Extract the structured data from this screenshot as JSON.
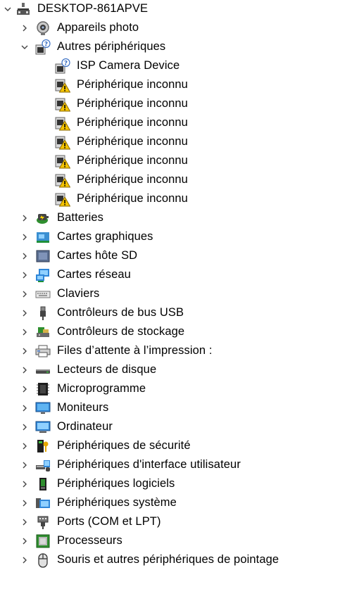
{
  "root": {
    "label": "DESKTOP-861APVE",
    "icon": "computer-tree-icon",
    "expanded": true
  },
  "categories": [
    {
      "label": "Appareils photo",
      "icon": "camera-icon",
      "expanded": false
    },
    {
      "label": "Autres périphériques",
      "icon": "unknown-device-icon",
      "expanded": true,
      "children": [
        {
          "label": "ISP Camera Device",
          "icon": "unknown-device-icon"
        },
        {
          "label": "Périphérique inconnu",
          "icon": "warning-device-icon"
        },
        {
          "label": "Périphérique inconnu",
          "icon": "warning-device-icon"
        },
        {
          "label": "Périphérique inconnu",
          "icon": "warning-device-icon"
        },
        {
          "label": "Périphérique inconnu",
          "icon": "warning-device-icon"
        },
        {
          "label": "Périphérique inconnu",
          "icon": "warning-device-icon"
        },
        {
          "label": "Périphérique inconnu",
          "icon": "warning-device-icon"
        },
        {
          "label": "Périphérique inconnu",
          "icon": "warning-device-icon"
        }
      ]
    },
    {
      "label": "Batteries",
      "icon": "battery-icon",
      "expanded": false
    },
    {
      "label": "Cartes graphiques",
      "icon": "display-adapter-icon",
      "expanded": false
    },
    {
      "label": "Cartes hôte SD",
      "icon": "sd-host-icon",
      "expanded": false
    },
    {
      "label": "Cartes réseau",
      "icon": "network-adapter-icon",
      "expanded": false
    },
    {
      "label": "Claviers",
      "icon": "keyboard-icon",
      "expanded": false
    },
    {
      "label": "Contrôleurs de bus USB",
      "icon": "usb-icon",
      "expanded": false
    },
    {
      "label": "Contrôleurs de stockage",
      "icon": "storage-controller-icon",
      "expanded": false
    },
    {
      "label": "Files d’attente à l’impression :",
      "icon": "printer-icon",
      "expanded": false
    },
    {
      "label": "Lecteurs de disque",
      "icon": "disk-drive-icon",
      "expanded": false
    },
    {
      "label": "Microprogramme",
      "icon": "firmware-icon",
      "expanded": false
    },
    {
      "label": "Moniteurs",
      "icon": "monitor-icon",
      "expanded": false
    },
    {
      "label": "Ordinateur",
      "icon": "computer-icon",
      "expanded": false
    },
    {
      "label": "Périphériques de sécurité",
      "icon": "security-device-icon",
      "expanded": false
    },
    {
      "label": "Périphériques d'interface utilisateur",
      "icon": "hid-icon",
      "expanded": false
    },
    {
      "label": "Périphériques logiciels",
      "icon": "software-device-icon",
      "expanded": false
    },
    {
      "label": "Périphériques système",
      "icon": "system-device-icon",
      "expanded": false
    },
    {
      "label": "Ports (COM et LPT)",
      "icon": "port-icon",
      "expanded": false
    },
    {
      "label": "Processeurs",
      "icon": "processor-icon",
      "expanded": false
    },
    {
      "label": "Souris et autres périphériques de pointage",
      "icon": "mouse-icon",
      "expanded": false
    }
  ]
}
